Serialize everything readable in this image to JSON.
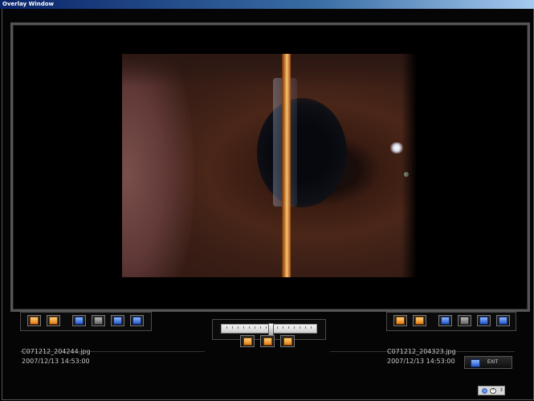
{
  "window": {
    "title": "Overlay Window"
  },
  "colors": {
    "accent_orange": "#e07a10",
    "accent_blue": "#2457c8",
    "background": "#000000"
  },
  "left_panel": {
    "toolbar": [
      "first-frame-icon",
      "previous-frame-icon",
      "import-icon",
      "stop-icon",
      "sum-icon",
      "fit-icon"
    ],
    "filename": "C071212_204244.jpg",
    "timestamp": "2007/12/13 14:53:00"
  },
  "right_panel": {
    "toolbar": [
      "first-frame-icon",
      "previous-frame-icon",
      "import-icon",
      "stop-icon",
      "sum-icon",
      "fit-icon"
    ],
    "filename": "C071212_204323.jpg",
    "timestamp": "2007/12/13 14:53:00"
  },
  "center": {
    "opacity_slider": {
      "value_fraction": 0.5
    },
    "buttons": [
      "overlay-left-icon",
      "overlay-blend-icon",
      "overlay-right-icon"
    ]
  },
  "exit_button": {
    "label": "EXIT"
  },
  "status": {
    "icons": [
      "globe-icon",
      "help-icon",
      "spin-icon"
    ]
  }
}
